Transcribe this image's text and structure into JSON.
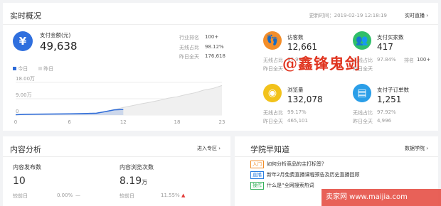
{
  "realtime": {
    "title": "实时概况",
    "updated_label": "更新时间：2019-02-19 12:18:19",
    "live_link": "实时直播",
    "payment": {
      "label": "支付金额(元)",
      "value": "49,638",
      "rank_label": "行业排名",
      "rank_value": "100+",
      "wireless_label": "无线占比",
      "wireless_value": "98.12%",
      "yesterday_label": "昨日全天",
      "yesterday_value": "176,618"
    },
    "legend": {
      "today": "今日",
      "yesterday": "昨日"
    },
    "y_ticks": [
      "18.00万",
      "9.00万",
      "0"
    ],
    "x_ticks": [
      "0",
      "6",
      "12",
      "18",
      "23"
    ],
    "metrics": [
      {
        "icon": "visitor-icon",
        "title": "访客数",
        "value": "12,661",
        "wireless_label": "无线占比",
        "wireless_value": "97.99%",
        "yesterday_label": "昨日全天",
        "yesterday_value": "",
        "color": "#f38e2a"
      },
      {
        "icon": "buyer-icon",
        "title": "支付买家数",
        "value": "417",
        "wireless_label": "无线占比",
        "wireless_value": "97.84%",
        "rank_label": "排名",
        "rank_value": "100+",
        "yesterday_label": "昨日全天",
        "yesterday_value": "",
        "color": "#2fbf6a"
      },
      {
        "icon": "eye-icon",
        "title": "浏览量",
        "value": "132,078",
        "wireless_label": "无线占比",
        "wireless_value": "99.17%",
        "yesterday_label": "昨日全天",
        "yesterday_value": "465,101",
        "color": "#f2c21b"
      },
      {
        "icon": "order-icon",
        "title": "支付子订单数",
        "value": "1,251",
        "wireless_label": "无线占比",
        "wireless_value": "97.92%",
        "yesterday_label": "昨日全天",
        "yesterday_value": "4,996",
        "color": "#2a9ee8"
      }
    ]
  },
  "chart_data": {
    "type": "area",
    "x": [
      0,
      1,
      2,
      3,
      4,
      5,
      6,
      7,
      8,
      9,
      10,
      11,
      12,
      13,
      14,
      15,
      16,
      17,
      18,
      19,
      20,
      21,
      22,
      23
    ],
    "xlim": [
      0,
      23
    ],
    "ylim": [
      0,
      180000
    ],
    "series": [
      {
        "name": "今日",
        "values": [
          2000,
          4000,
          5000,
          5500,
          6000,
          6500,
          7000,
          8000,
          9000,
          10500,
          19000,
          29000,
          31000
        ],
        "color": "#2d6bd8"
      },
      {
        "name": "昨日",
        "values": [
          2000,
          4000,
          5000,
          5500,
          6000,
          6500,
          7000,
          8000,
          9000,
          11000,
          20000,
          30000,
          42000,
          52000,
          62000,
          71000,
          81000,
          93000,
          101000,
          113000,
          123000,
          138000,
          147000,
          163000
        ],
        "color": "#e6e6e6"
      }
    ],
    "grid": true
  },
  "content": {
    "title": "内容分析",
    "link": "进入专区",
    "published_label": "内容发布数",
    "published_value": "10",
    "views_label": "内容浏览次数",
    "views_value": "8.19",
    "views_unit": "万",
    "compare1_label": "较前日",
    "compare1_value": "0.00%",
    "compare1_dash": "—",
    "compare2_label": "较前日",
    "compare2_value": "11.55%"
  },
  "school": {
    "title": "学院早知道",
    "link": "数据学院",
    "items": [
      {
        "tag": "入门",
        "text": "如何分析竞品的主打标签？",
        "tag_color": "#f08a24"
      },
      {
        "tag": "直播",
        "text": "新年2月免费直播课程预告及历史直播回顾",
        "tag_color": "#2a7ee0"
      },
      {
        "tag": "操作",
        "text": "什么是“全网搜索热词",
        "tag_color": "#34b05a"
      }
    ]
  },
  "watermark": "@鑫锋鬼剑",
  "corner_watermark": "卖家网 www.maijia.com"
}
